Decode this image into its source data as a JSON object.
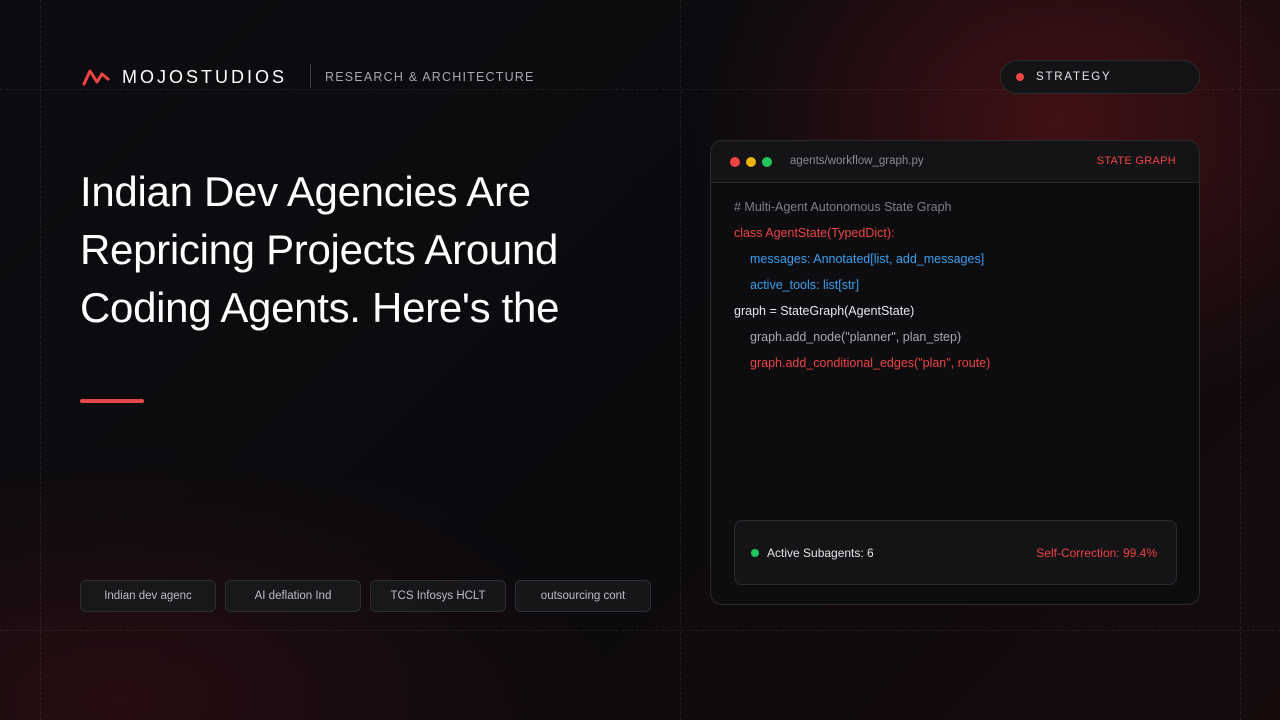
{
  "brand": {
    "name": "MOJOSTUDIOS",
    "subtitle": "RESEARCH & ARCHITECTURE"
  },
  "category_pill": {
    "label": "STRATEGY"
  },
  "headline": {
    "lines": [
      "Indian Dev Agencies Are",
      "Repricing Projects Around",
      "Coding Agents. Here's the"
    ]
  },
  "tags": [
    "Indian dev agenc",
    "AI deflation Ind",
    "TCS Infosys HCLT",
    "outsourcing cont"
  ],
  "code_window": {
    "filename": "agents/workflow_graph.py",
    "tag": "STATE GRAPH",
    "lines": [
      {
        "text": "# Multi-Agent Autonomous State Graph",
        "color": "comment",
        "indent": false
      },
      {
        "text": "class AgentState(TypedDict):",
        "color": "red",
        "indent": false
      },
      {
        "text": "messages: Annotated[list, add_messages]",
        "color": "blue",
        "indent": true
      },
      {
        "text": "active_tools: list[str]",
        "color": "blue",
        "indent": true
      },
      {
        "text": "graph = StateGraph(AgentState)",
        "color": "white",
        "indent": false
      },
      {
        "text": "graph.add_node(\"planner\", plan_step)",
        "color": "gray",
        "indent": true
      },
      {
        "text": "graph.add_conditional_edges(\"plan\", route)",
        "color": "red",
        "indent": true
      }
    ],
    "status": {
      "left": "Active Subagents: 6",
      "right": "Self-Correction: 99.4%"
    }
  },
  "colors": {
    "accent_red": "#ef4444",
    "accent_blue": "#3ba0f0",
    "status_green": "#22c55e",
    "traffic_yellow": "#eab308"
  }
}
